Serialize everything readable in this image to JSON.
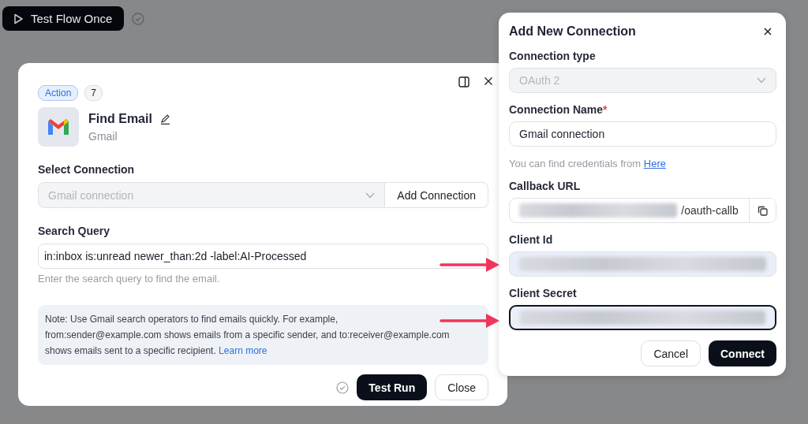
{
  "toolbar": {
    "test_button": "Test Flow Once"
  },
  "step_panel": {
    "badge": "Action",
    "count": "7",
    "title": "Find Email",
    "app": "Gmail",
    "connection": {
      "label": "Select Connection",
      "value": "Gmail connection",
      "disabled": true,
      "button": "Add Connection"
    },
    "query": {
      "label": "Search Query",
      "value": "in:inbox is:unread newer_than:2d -label:AI-Processed",
      "hint": "Enter the search query to find the email."
    },
    "note": {
      "text": "Note: Use Gmail search operators to find emails quickly. For example, from:sender@example.com shows emails from a specific sender, and to:receiver@example.com shows emails sent to a specific recipient.",
      "link": "Learn more"
    },
    "buttons": [
      {
        "label": "Test Run",
        "kind": "primary"
      },
      {
        "label": "Close",
        "kind": "secondary"
      }
    ]
  },
  "dialog": {
    "title": "Add New Connection",
    "fields": [
      {
        "kind": "select",
        "label": "Connection type",
        "value": "OAuth 2",
        "disabled": true
      },
      {
        "kind": "text",
        "label": "Connection Name",
        "required_mark": "*",
        "value": "Gmail connection",
        "hint": "You can find credentials from",
        "hint_link": "Here"
      },
      {
        "kind": "copy",
        "label": "Callback URL",
        "value": "/oauth-callb",
        "redacted": true
      },
      {
        "kind": "text",
        "label": "Client Id",
        "redacted": true,
        "focused": false
      },
      {
        "kind": "text",
        "label": "Client Secret",
        "redacted": true,
        "focused": true
      }
    ],
    "buttons": [
      {
        "label": "Cancel",
        "kind": "secondary"
      },
      {
        "label": "Connect",
        "kind": "primary"
      }
    ]
  }
}
